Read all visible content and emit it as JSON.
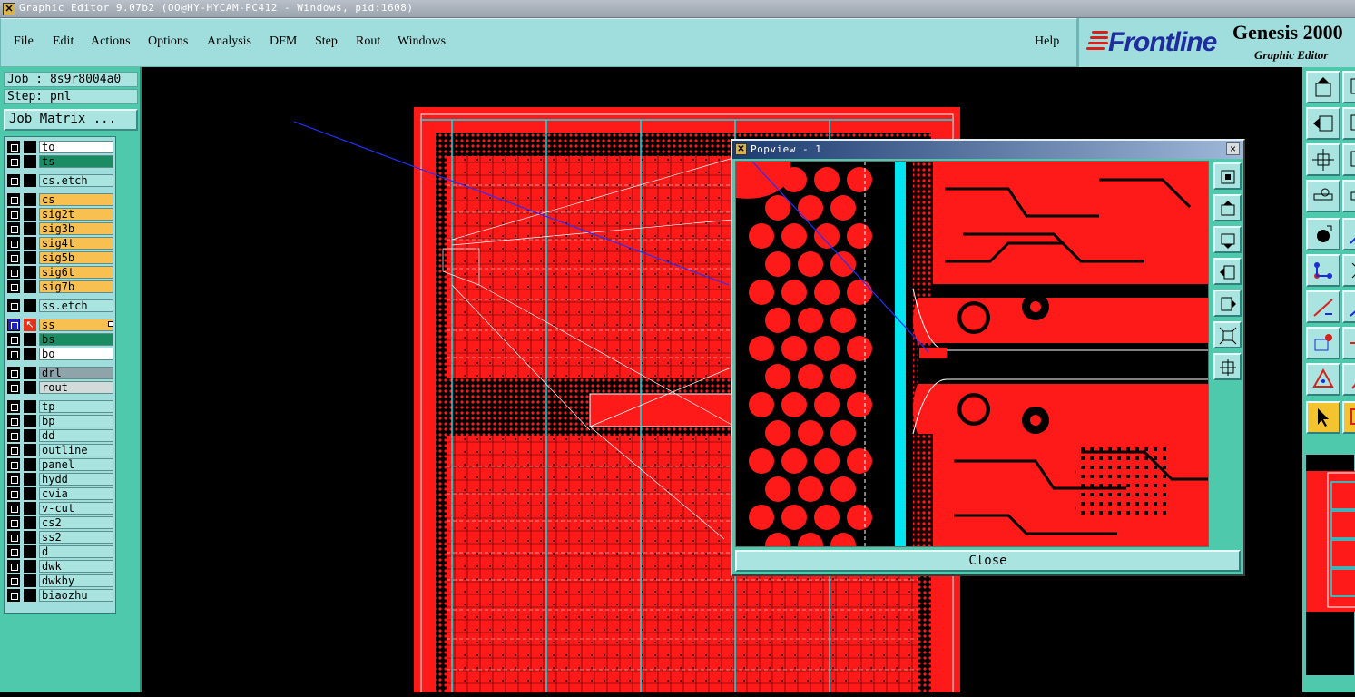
{
  "window": {
    "title": "Graphic Editor 9.07b2 (OO@HY-HYCAM-PC412 - Windows, pid:1608)",
    "icon": "app-icon"
  },
  "menu": {
    "items": [
      {
        "label": "File"
      },
      {
        "label": "Edit"
      },
      {
        "label": "Actions"
      },
      {
        "label": "Options"
      },
      {
        "label": "Analysis"
      },
      {
        "label": "DFM"
      },
      {
        "label": "Step"
      },
      {
        "label": "Rout"
      },
      {
        "label": "Windows"
      }
    ],
    "help": "Help"
  },
  "brand": {
    "logo": "Frontline",
    "product": "Genesis 2000",
    "subtitle": "Graphic Editor",
    "colors": {
      "logo_text": "#1e2c9e",
      "logo_mark": "#d8201c"
    }
  },
  "job": {
    "job_label": "Job : 8s9r8004a0",
    "step_label": "Step: pnl",
    "matrix_button": "Job Matrix ..."
  },
  "layers": [
    {
      "name": "to",
      "color": "white"
    },
    {
      "name": "ts",
      "color": "green"
    },
    {
      "name": "cs.etch",
      "color": "cyan"
    },
    {
      "name": "cs",
      "color": "orange"
    },
    {
      "name": "sig2t",
      "color": "orange"
    },
    {
      "name": "sig3b",
      "color": "orange"
    },
    {
      "name": "sig4t",
      "color": "orange"
    },
    {
      "name": "sig5b",
      "color": "orange"
    },
    {
      "name": "sig6t",
      "color": "orange"
    },
    {
      "name": "sig7b",
      "color": "orange"
    },
    {
      "name": "ss.etch",
      "color": "cyan"
    },
    {
      "name": "ss",
      "color": "orange",
      "active": true
    },
    {
      "name": "bs",
      "color": "green"
    },
    {
      "name": "bo",
      "color": "white"
    },
    {
      "name": "drl",
      "color": "gray"
    },
    {
      "name": "rout",
      "color": "lgray"
    },
    {
      "name": "tp",
      "color": "cyan"
    },
    {
      "name": "bp",
      "color": "cyan"
    },
    {
      "name": "dd",
      "color": "cyan"
    },
    {
      "name": "outline",
      "color": "cyan"
    },
    {
      "name": "panel",
      "color": "cyan"
    },
    {
      "name": "hydd",
      "color": "cyan"
    },
    {
      "name": "cvia",
      "color": "cyan"
    },
    {
      "name": "v-cut",
      "color": "cyan"
    },
    {
      "name": "cs2",
      "color": "cyan"
    },
    {
      "name": "ss2",
      "color": "cyan"
    },
    {
      "name": "d",
      "color": "cyan"
    },
    {
      "name": "dwk",
      "color": "cyan"
    },
    {
      "name": "dwkby",
      "color": "cyan"
    },
    {
      "name": "biaozhu",
      "color": "cyan"
    }
  ],
  "popview": {
    "title": "Popview - 1",
    "close_label": "Close",
    "close_x": "×"
  },
  "colors": {
    "copper": "#ff1a1a",
    "panel_bg": "#4fc9ab",
    "menu_bg": "#9fdedd",
    "cyan_line": "#00e5f0"
  }
}
